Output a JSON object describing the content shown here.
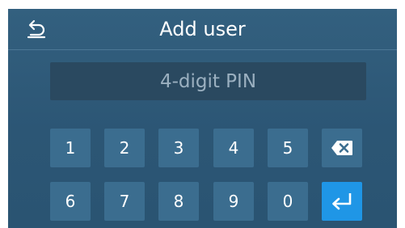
{
  "header": {
    "back_icon": "back-arrow-icon",
    "title": "Add user"
  },
  "pin": {
    "placeholder": "4-digit PIN",
    "value": ""
  },
  "keypad": {
    "row1": [
      "1",
      "2",
      "3",
      "4",
      "5"
    ],
    "row2": [
      "6",
      "7",
      "8",
      "9",
      "0"
    ],
    "backspace_icon": "backspace-icon",
    "enter_icon": "enter-return-icon"
  },
  "colors": {
    "background": "#2c5675",
    "key": "#3b6d8f",
    "enter_key": "#1f96e6",
    "field": "#2a4960"
  }
}
